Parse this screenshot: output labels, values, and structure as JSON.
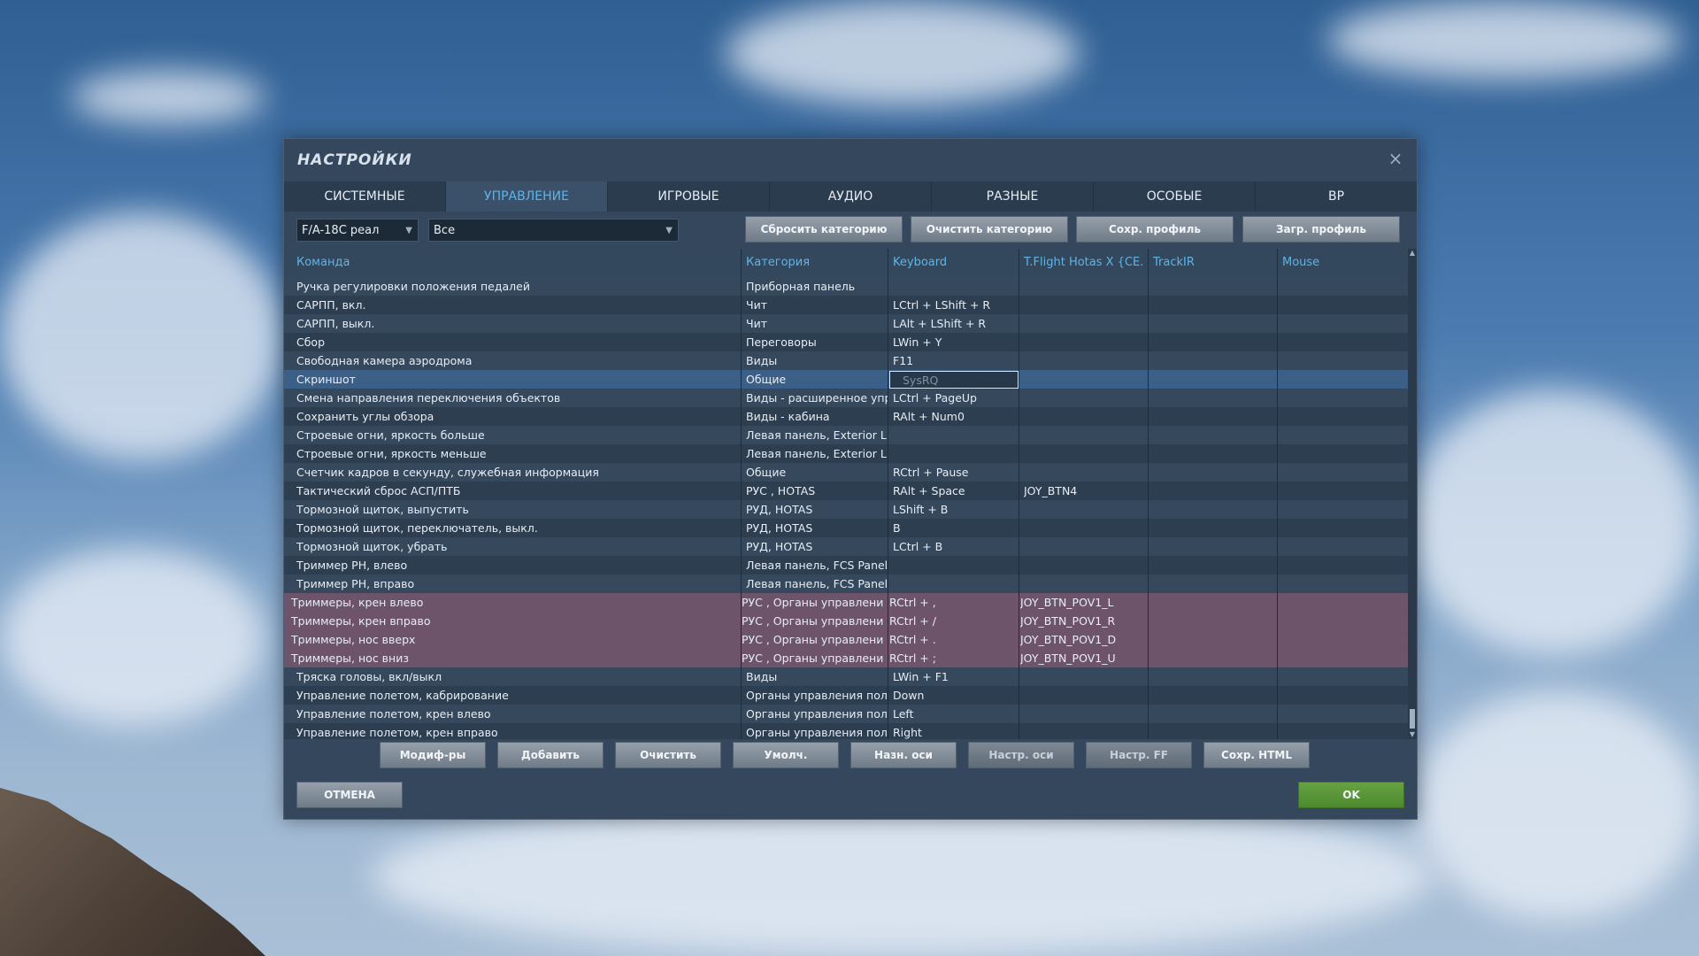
{
  "dialog": {
    "title": "НАСТРОЙКИ",
    "close_icon": "×"
  },
  "tabs": [
    {
      "label": "СИСТЕМНЫЕ",
      "active": false
    },
    {
      "label": "УПРАВЛЕНИЕ",
      "active": true
    },
    {
      "label": "ИГРОВЫЕ",
      "active": false
    },
    {
      "label": "АУДИО",
      "active": false
    },
    {
      "label": "РАЗНЫЕ",
      "active": false
    },
    {
      "label": "ОСОБЫЕ",
      "active": false
    },
    {
      "label": "ВР",
      "active": false
    }
  ],
  "toolbar": {
    "aircraft_select": "F/A-18C реал",
    "category_select": "Все",
    "reset_category": "Сбросить категорию",
    "clear_category": "Очистить категорию",
    "save_profile": "Сохр. профиль",
    "load_profile": "Загр. профиль"
  },
  "table": {
    "headers": [
      "Команда",
      "Категория",
      "Keyboard",
      "T.Flight Hotas X {CE...",
      "TrackIR",
      "Mouse"
    ],
    "rows": [
      {
        "command": "Ручка регулировки положения педалей",
        "category": "Приборная панель",
        "keyboard": "",
        "joystick": "",
        "state": "even"
      },
      {
        "command": "САРПП, вкл.",
        "category": "Чит",
        "keyboard": "LCtrl + LShift + R",
        "joystick": "",
        "state": "odd"
      },
      {
        "command": "САРПП, выкл.",
        "category": "Чит",
        "keyboard": "LAlt + LShift + R",
        "joystick": "",
        "state": "even"
      },
      {
        "command": "Сбор",
        "category": "Переговоры",
        "keyboard": "LWin + Y",
        "joystick": "",
        "state": "odd"
      },
      {
        "command": "Свободная камера аэродрома",
        "category": "Виды",
        "keyboard": "F11",
        "joystick": "",
        "state": "even"
      },
      {
        "command": "Скриншот",
        "category": "Общие",
        "keyboard": "SysRQ",
        "joystick": "",
        "state": "sel"
      },
      {
        "command": "Смена направления переключения объектов",
        "category": "Виды - расширенное упр",
        "keyboard": "LCtrl + PageUp",
        "joystick": "",
        "state": "even"
      },
      {
        "command": "Сохранить углы обзора",
        "category": "Виды - кабина",
        "keyboard": "RAlt + Num0",
        "joystick": "",
        "state": "odd"
      },
      {
        "command": "Строевые огни, яркость больше",
        "category": "Левая панель, Exterior L",
        "keyboard": "",
        "joystick": "",
        "state": "even"
      },
      {
        "command": "Строевые огни, яркость меньше",
        "category": "Левая панель, Exterior L",
        "keyboard": "",
        "joystick": "",
        "state": "odd"
      },
      {
        "command": "Счетчик кадров в секунду, служебная информация",
        "category": "Общие",
        "keyboard": "RCtrl + Pause",
        "joystick": "",
        "state": "even"
      },
      {
        "command": "Тактический сброс АСП/ПТБ",
        "category": "РУС , HOTAS",
        "keyboard": "RAlt + Space",
        "joystick": "JOY_BTN4",
        "state": "odd"
      },
      {
        "command": "Тормозной щиток, выпустить",
        "category": "РУД, HOTAS",
        "keyboard": "LShift + B",
        "joystick": "",
        "state": "even"
      },
      {
        "command": "Тормозной щиток, переключатель, выкл.",
        "category": "РУД, HOTAS",
        "keyboard": "B",
        "joystick": "",
        "state": "odd"
      },
      {
        "command": "Тормозной щиток, убрать",
        "category": "РУД, HOTAS",
        "keyboard": "LCtrl + B",
        "joystick": "",
        "state": "even"
      },
      {
        "command": "Триммер РН, влево",
        "category": "Левая панель, FCS Panel",
        "keyboard": "",
        "joystick": "",
        "state": "odd"
      },
      {
        "command": "Триммер РН, вправо",
        "category": "Левая панель, FCS Panel",
        "keyboard": "",
        "joystick": "",
        "state": "even"
      },
      {
        "command": "Триммеры, крен влево",
        "category": "РУС , Органы управления",
        "keyboard": "RCtrl + ,",
        "joystick": "JOY_BTN_POV1_L",
        "state": "pink"
      },
      {
        "command": "Триммеры, крен вправо",
        "category": "РУС , Органы управления",
        "keyboard": "RCtrl + /",
        "joystick": "JOY_BTN_POV1_R",
        "state": "pink"
      },
      {
        "command": "Триммеры, нос вверх",
        "category": "РУС , Органы управления",
        "keyboard": "RCtrl + .",
        "joystick": "JOY_BTN_POV1_D",
        "state": "pink"
      },
      {
        "command": "Триммеры, нос вниз",
        "category": "РУС , Органы управления",
        "keyboard": "RCtrl + ;",
        "joystick": "JOY_BTN_POV1_U",
        "state": "pink"
      },
      {
        "command": "Тряска головы, вкл/выкл",
        "category": "Виды",
        "keyboard": "LWin + F1",
        "joystick": "",
        "state": "even"
      },
      {
        "command": "Управление полетом, кабрирование",
        "category": "Органы управления пол",
        "keyboard": "Down",
        "joystick": "",
        "state": "odd"
      },
      {
        "command": "Управление полетом, крен влево",
        "category": "Органы управления пол",
        "keyboard": "Left",
        "joystick": "",
        "state": "even"
      },
      {
        "command": "Управление полетом, крен вправо",
        "category": "Органы управления пол",
        "keyboard": "Right",
        "joystick": "",
        "state": "odd"
      }
    ]
  },
  "bottom_buttons": [
    {
      "label": "Модиф-ры",
      "enabled": true
    },
    {
      "label": "Добавить",
      "enabled": true
    },
    {
      "label": "Очистить",
      "enabled": true
    },
    {
      "label": "Умолч.",
      "enabled": true
    },
    {
      "label": "Назн. оси",
      "enabled": true
    },
    {
      "label": "Настр. оси",
      "enabled": false
    },
    {
      "label": "Настр. FF",
      "enabled": false
    },
    {
      "label": "Сохр. HTML",
      "enabled": true
    }
  ],
  "footer": {
    "cancel": "ОТМЕНА",
    "ok": "OK"
  }
}
